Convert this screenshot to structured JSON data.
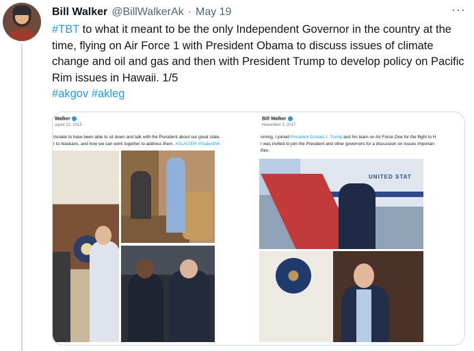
{
  "author": {
    "name": "Bill Walker",
    "handle": "@BillWalkerAk",
    "separator": "·",
    "date": "May 19"
  },
  "more_label": "···",
  "tweet": {
    "hashtag_tbt": "#TBT",
    "body": " to what it meant to be the only Independent Governor in the country at the time, flying on Air Force 1 with President Obama to discuss issues of climate change and oil and gas and then with President Trump to develop policy on Pacific Rim issues in Hawaii. 1/5",
    "hashtag_akgov": "#akgov",
    "hashtag_akleg": "#akleg"
  },
  "media": {
    "left_card": {
      "name": "Walker",
      "date": "ugust 31, 2015 ·",
      "line1": "rtunate to have been able to sit down and talk with the President about our great state,",
      "line2_text": "r to Alaskans, and how we can work together to address them. ",
      "line2_link": "#GLACIER #StateofAK"
    },
    "right_card": {
      "name": "Bill Walker",
      "date": "November 3, 2017 ·",
      "line1_pre": "orning, I joined ",
      "line1_link": "President Donald J. Trump",
      "line1_post": " and his team on Air Force One for the flight to H",
      "line2": "I was invited to join the President and other governors for a discussion on issues importan",
      "line3": "Rim.",
      "plane_label": "UNITED STAT"
    }
  },
  "colors": {
    "link": "#1d9bf0",
    "text": "#0f1419",
    "muted": "#536471",
    "border": "#cfd9de"
  }
}
